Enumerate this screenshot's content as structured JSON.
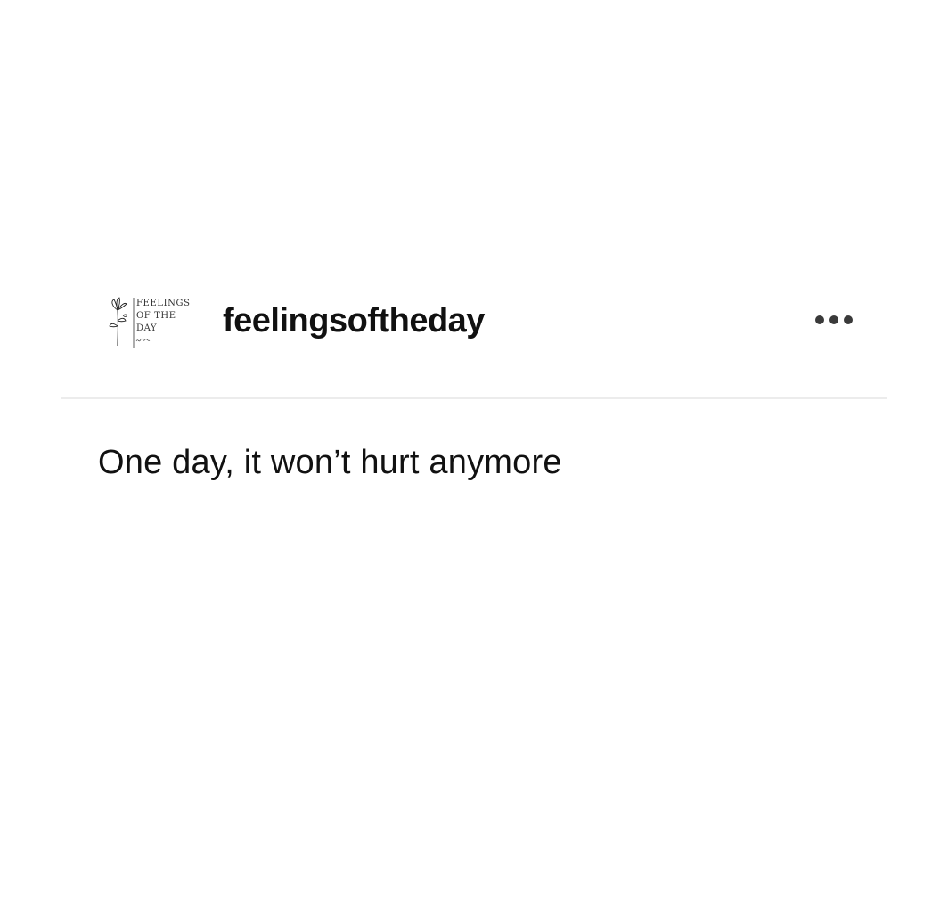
{
  "post": {
    "avatar": {
      "logo_text": [
        "FEELINGS",
        "OF THE",
        "DAY"
      ],
      "icon": "flower-logo-icon"
    },
    "username": "feelingsoftheday",
    "more_icon": "ellipsis-icon",
    "body_text": "One day, it won’t hurt anymore"
  },
  "colors": {
    "background": "#ffffff",
    "text": "#111111",
    "divider": "#ececec"
  }
}
